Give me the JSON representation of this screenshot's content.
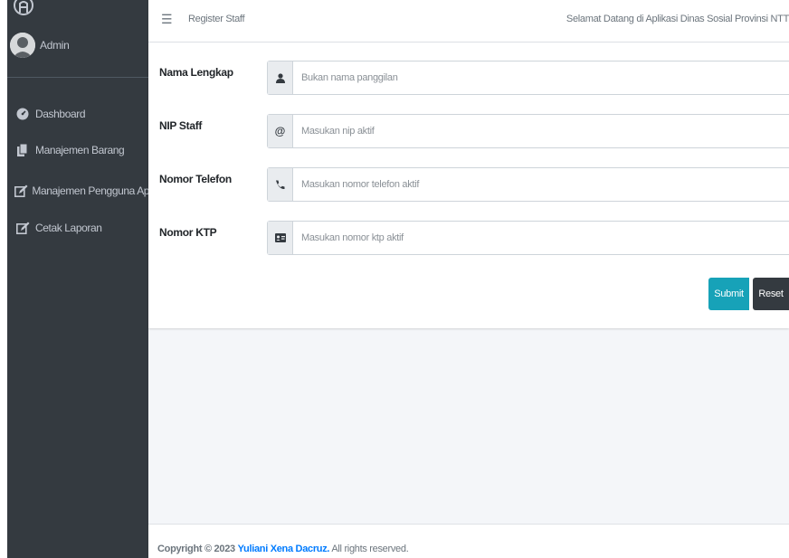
{
  "sidebar": {
    "user_name": "Admin",
    "items": [
      {
        "label": "Dashboard",
        "icon": "tachometer-icon"
      },
      {
        "label": "Manajemen Barang",
        "icon": "copy-icon"
      },
      {
        "label": "Manajemen Pengguna Aplikasi",
        "icon": "edit-icon"
      },
      {
        "label": "Cetak Laporan",
        "icon": "edit-icon"
      }
    ]
  },
  "header": {
    "breadcrumb": "Register Staff",
    "welcome": "Selamat Datang di Aplikasi Dinas Sosial Provinsi NTT"
  },
  "form": {
    "fields": [
      {
        "label": "Nama Lengkap",
        "placeholder": "Bukan nama panggilan",
        "value": "",
        "icon": "user-icon"
      },
      {
        "label": "NIP Staff",
        "placeholder": "Masukan nip aktif",
        "value": "",
        "icon": "at-icon"
      },
      {
        "label": "Nomor Telefon",
        "placeholder": "Masukan nomor telefon aktif",
        "value": "",
        "icon": "phone-icon"
      },
      {
        "label": "Nomor KTP",
        "placeholder": "Masukan nomor ktp aktif",
        "value": "",
        "icon": "id-card-icon"
      }
    ],
    "submit_label": "Submit",
    "reset_label": "Reset"
  },
  "footer": {
    "prefix": "Copyright © 2023",
    "author": "Yuliani Xena Dacruz.",
    "suffix": "All rights reserved."
  },
  "colors": {
    "sidebar_bg": "#343a40",
    "submit": "#17a2b8",
    "reset": "#343a40",
    "link": "#007bff"
  }
}
